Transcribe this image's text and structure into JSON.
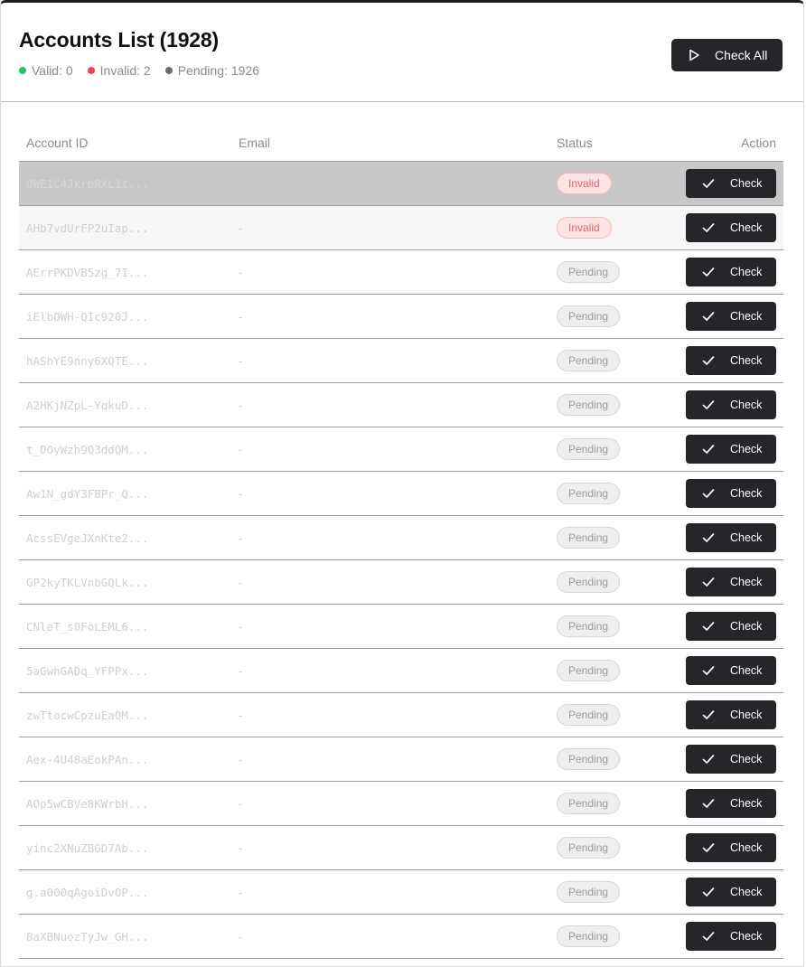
{
  "header": {
    "title": "Accounts List (1928)",
    "stats": [
      {
        "label": "Valid: 0",
        "color": "#22c55e"
      },
      {
        "label": "Invalid: 2",
        "color": "#ef4444"
      },
      {
        "label": "Pending: 1926",
        "color": "#6b6b6b"
      }
    ],
    "check_all_label": "Check All",
    "check_all_icon": "play-icon"
  },
  "table": {
    "columns": [
      "Account ID",
      "Email",
      "Status",
      "Action"
    ],
    "action_label": "Check",
    "action_icon": "checkmark-icon",
    "rows": [
      {
        "id": "QWE1C4JkrbRXL1t...",
        "email": "-",
        "status": "Invalid",
        "state": "selected"
      },
      {
        "id": "AHb7vdUrFP2uIap...",
        "email": "-",
        "status": "Invalid",
        "state": "hovered"
      },
      {
        "id": "AErrPKDVB5zg_7I...",
        "email": "-",
        "status": "Pending",
        "state": ""
      },
      {
        "id": "iElbOWH-QIc920J...",
        "email": "-",
        "status": "Pending",
        "state": ""
      },
      {
        "id": "hAShYE9nny6XQTE...",
        "email": "-",
        "status": "Pending",
        "state": ""
      },
      {
        "id": "A2HKjNZpL-YqkuD...",
        "email": "-",
        "status": "Pending",
        "state": ""
      },
      {
        "id": "t_OOyWzh9Q3ddQM...",
        "email": "-",
        "status": "Pending",
        "state": ""
      },
      {
        "id": "Aw1N_gdY3FBPr_Q...",
        "email": "-",
        "status": "Pending",
        "state": ""
      },
      {
        "id": "AcssEVgeJXnKte2...",
        "email": "-",
        "status": "Pending",
        "state": ""
      },
      {
        "id": "GP2kyTKLVnbGQLk...",
        "email": "-",
        "status": "Pending",
        "state": ""
      },
      {
        "id": "CNleT_s0FoLEML6...",
        "email": "-",
        "status": "Pending",
        "state": ""
      },
      {
        "id": "5aGwhGADq_YFPPx...",
        "email": "-",
        "status": "Pending",
        "state": ""
      },
      {
        "id": "zwTtocwCpzuEaQM...",
        "email": "-",
        "status": "Pending",
        "state": ""
      },
      {
        "id": "Aex-4U48aEokPAn...",
        "email": "-",
        "status": "Pending",
        "state": ""
      },
      {
        "id": "AOp5wCBVe8KWrbH...",
        "email": "-",
        "status": "Pending",
        "state": ""
      },
      {
        "id": "yinc2XNuZBGD7Ab...",
        "email": "-",
        "status": "Pending",
        "state": ""
      },
      {
        "id": "g.a000qAgoiDvOP...",
        "email": "-",
        "status": "Pending",
        "state": ""
      },
      {
        "id": "8aXBNuozTyJw_GH...",
        "email": "-",
        "status": "Pending",
        "state": ""
      }
    ]
  }
}
